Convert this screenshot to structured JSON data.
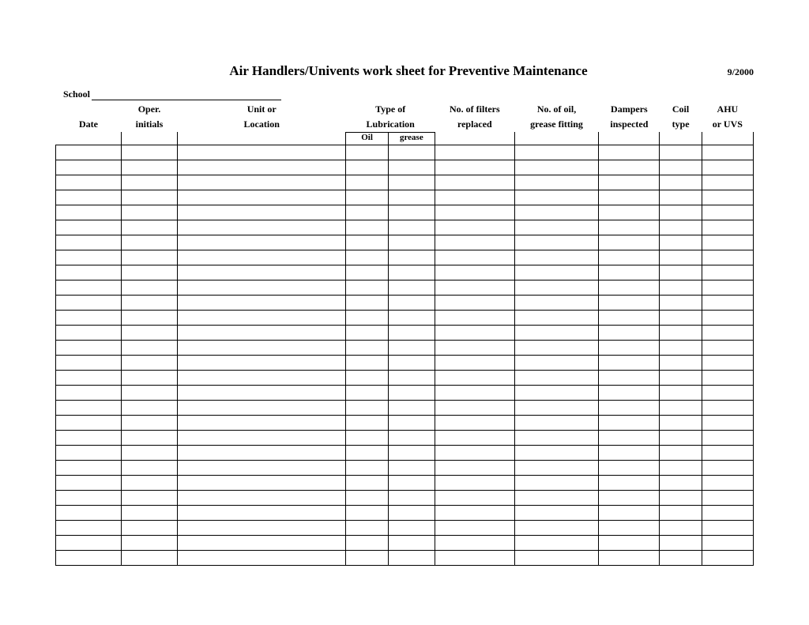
{
  "title": "Air Handlers/Univents work sheet for Preventive Maintenance",
  "date_stamp": "9/2000",
  "school_label": "School",
  "headers": {
    "date": "Date",
    "oper_initials_l1": "Oper.",
    "oper_initials_l2": "initials",
    "unit_loc_l1": "Unit or",
    "unit_loc_l2": "Location",
    "lube_l1": "Type of",
    "lube_l2": "Lubrication",
    "oil": "Oil",
    "grease": "grease",
    "filters_l1": "No. of  filters",
    "filters_l2": "replaced",
    "oilgrease_l1": "No. of oil,",
    "oilgrease_l2": "grease fitting",
    "dampers_l1": "Dampers",
    "dampers_l2": "inspected",
    "coil_l1": "Coil",
    "coil_l2": "type",
    "ahu_l1": "AHU",
    "ahu_l2": "or UVS"
  },
  "row_count": 28
}
